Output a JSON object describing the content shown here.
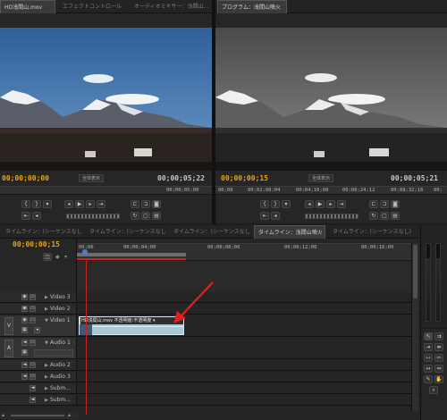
{
  "source_monitor": {
    "tabs": [
      {
        "label": "HD浅間山.mov"
      },
      {
        "label": "エフェクトコントロール"
      },
      {
        "label": "オーディオミキサー：浅間山..."
      }
    ],
    "timecode_current": "00;00;00;00",
    "zoom_label": "全体表示",
    "timecode_duration": "00;00;05;22",
    "ruler_label": "00;00;05;00"
  },
  "program_monitor": {
    "tabs": [
      {
        "label": "プログラム：浅間山噴火"
      }
    ],
    "timecode_current": "00;00;00;15",
    "zoom_label": "全体表示",
    "timecode_duration": "00;00;05;21",
    "ruler_labels": [
      "00;00",
      "00;02;08;04",
      "00;04;16;08",
      "00;06;24;12",
      "00;08;32;16",
      "00;"
    ]
  },
  "timeline": {
    "tabs": [
      {
        "label": "タイムライン：(シーケンスなし)"
      },
      {
        "label": "タイムライン：(シーケンスなし)"
      },
      {
        "label": "タイムライン：(シーケンスなし)"
      },
      {
        "label": "タイムライン：浅間山噴火"
      },
      {
        "label": "タイムライン：(シーケンスなし)"
      }
    ],
    "timecode_current": "00;00;00;15",
    "ruler_labels": [
      "00;00",
      "00;00;04;00",
      "00;00;08;00",
      "00;00;12;00",
      "00;00;16;00"
    ],
    "tracks": [
      {
        "label": "Video 3"
      },
      {
        "label": "Video 2"
      },
      {
        "label": "Video 1"
      },
      {
        "label": "Audio 1"
      },
      {
        "label": "Audio 2"
      },
      {
        "label": "Audio 3"
      },
      {
        "label": "Subm..."
      },
      {
        "label": "Subm..."
      }
    ],
    "v_marker": "V",
    "a_marker": "A",
    "clip_label": "HD浅間山.mov 不透明度:不透明度 ▾"
  },
  "colors": {
    "accent_orange": "#e8a31a",
    "playhead_red": "#cc2222",
    "clip_fill": "#a9c9d6",
    "arrow_red": "#e22020"
  },
  "icons": [
    "marker-icon",
    "play-icon",
    "step-back-icon",
    "step-forward-icon",
    "loop-icon",
    "lift-icon",
    "extract-icon",
    "export-frame-icon",
    "eye-icon",
    "speaker-icon",
    "lock-icon",
    "selection-tool-icon",
    "razor-tool-icon",
    "hand-tool-icon",
    "zoom-tool-icon"
  ]
}
